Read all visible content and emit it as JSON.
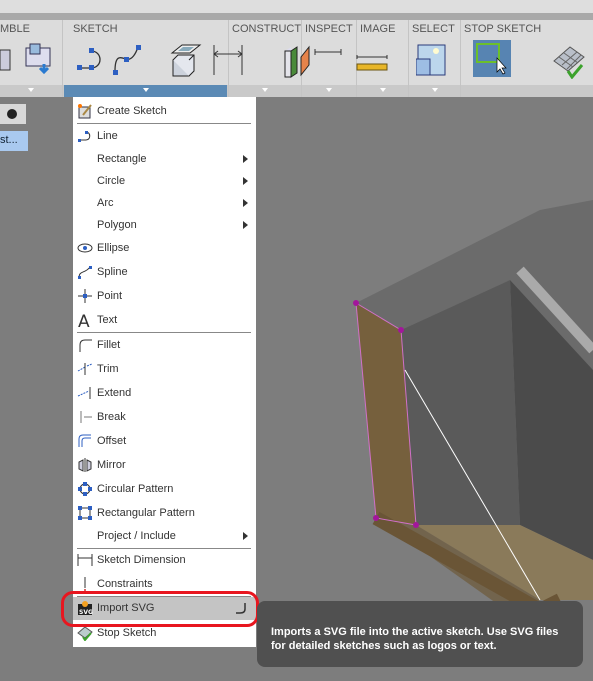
{
  "toolbar": {
    "sections": [
      {
        "label": "MBLE"
      },
      {
        "label": "SKETCH",
        "active": true
      },
      {
        "label": "CONSTRUCT"
      },
      {
        "label": "INSPECT"
      },
      {
        "label": "IMAGE"
      },
      {
        "label": "SELECT"
      },
      {
        "label": "STOP SKETCH"
      }
    ]
  },
  "left_panel": {
    "selected_item": "st..."
  },
  "menu": {
    "items": [
      {
        "label": "Create Sketch",
        "icon": "create-sketch-icon"
      },
      {
        "label": "Line",
        "icon": "line-icon"
      },
      {
        "label": "Rectangle",
        "submenu": true
      },
      {
        "label": "Circle",
        "submenu": true
      },
      {
        "label": "Arc",
        "submenu": true
      },
      {
        "label": "Polygon",
        "submenu": true
      },
      {
        "label": "Ellipse",
        "icon": "ellipse-icon"
      },
      {
        "label": "Spline",
        "icon": "spline-icon"
      },
      {
        "label": "Point",
        "icon": "point-icon"
      },
      {
        "label": "Text",
        "icon": "text-icon"
      },
      {
        "label": "Fillet",
        "icon": "fillet-icon"
      },
      {
        "label": "Trim",
        "icon": "trim-icon"
      },
      {
        "label": "Extend",
        "icon": "extend-icon"
      },
      {
        "label": "Break",
        "icon": "break-icon"
      },
      {
        "label": "Offset",
        "icon": "offset-icon"
      },
      {
        "label": "Mirror",
        "icon": "mirror-icon"
      },
      {
        "label": "Circular Pattern",
        "icon": "circular-pattern-icon"
      },
      {
        "label": "Rectangular Pattern",
        "icon": "rectangular-pattern-icon"
      },
      {
        "label": "Project / Include",
        "submenu": true
      },
      {
        "label": "Sketch Dimension",
        "icon": "sketch-dimension-icon"
      },
      {
        "label": "Constraints",
        "icon": "constraints-icon"
      },
      {
        "label": "Import SVG",
        "icon": "import-svg-icon",
        "highlighted": true
      },
      {
        "label": "Stop Sketch",
        "icon": "stop-sketch-icon"
      }
    ]
  },
  "tooltip": {
    "text": "Imports a SVG file into the active sketch. Use SVG files for detailed sketches such as logos or text."
  },
  "colors": {
    "accent": "#5b8ab5",
    "highlight_ring": "#e8161f",
    "tooltip_bg": "#505050"
  }
}
